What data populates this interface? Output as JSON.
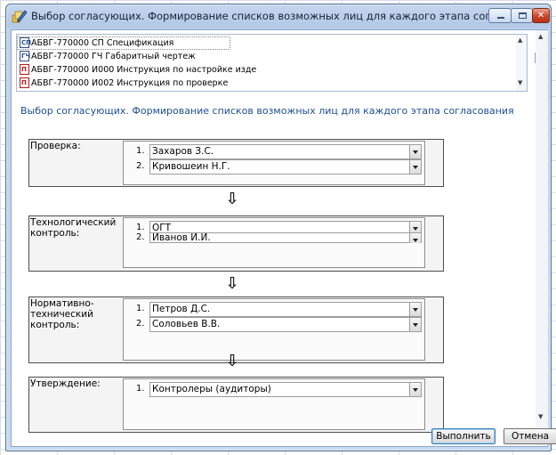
{
  "window": {
    "title": "Выбор согласующих. Формирование списков возможных лиц для каждого этапа согласования"
  },
  "documents": [
    {
      "icon": "spec-doc-icon",
      "glyph": "СП",
      "text": "АБВГ-770000 СП Спецификация"
    },
    {
      "icon": "drawing-doc-icon",
      "glyph": "ГЧ",
      "text": "АБВГ-770000 ГЧ Габаритный чертеж"
    },
    {
      "icon": "pdf-doc-icon",
      "glyph": "П",
      "text": "АБВГ-770000 И000 Инструкция по настройке изде"
    },
    {
      "icon": "pdf-doc-icon",
      "glyph": "П",
      "text": "АБВГ-770000 И002 Инструкция по проверке"
    }
  ],
  "section_heading": "Выбор согласующих. Формирование списков возможных лиц для каждого этапа согласования",
  "stages": [
    {
      "label": "Проверка:",
      "approvers": [
        {
          "num": "1.",
          "name": "Захаров З.С."
        },
        {
          "num": "2.",
          "name": "Кривошеин Н.Г."
        }
      ]
    },
    {
      "label": "Технологический контроль:",
      "approvers": [
        {
          "num": "1.",
          "name": "ОГТ"
        },
        {
          "num": "2.",
          "name": "Иванов И.И."
        }
      ]
    },
    {
      "label": "Нормативно-технический контроль:",
      "approvers": [
        {
          "num": "1.",
          "name": "Петров Д.С."
        },
        {
          "num": "2.",
          "name": "Соловьев В.В."
        }
      ]
    },
    {
      "label": "Утверждение:",
      "approvers": [
        {
          "num": "1.",
          "name": "Контролеры (аудиторы)"
        }
      ]
    }
  ],
  "flow_arrow": "⇩",
  "buttons": {
    "run": "Выполнить",
    "cancel": "Отмена"
  },
  "colors": {
    "title_bar": "#b2c8e4",
    "heading_text": "#1f4f94",
    "close_button": "#c9462c"
  }
}
